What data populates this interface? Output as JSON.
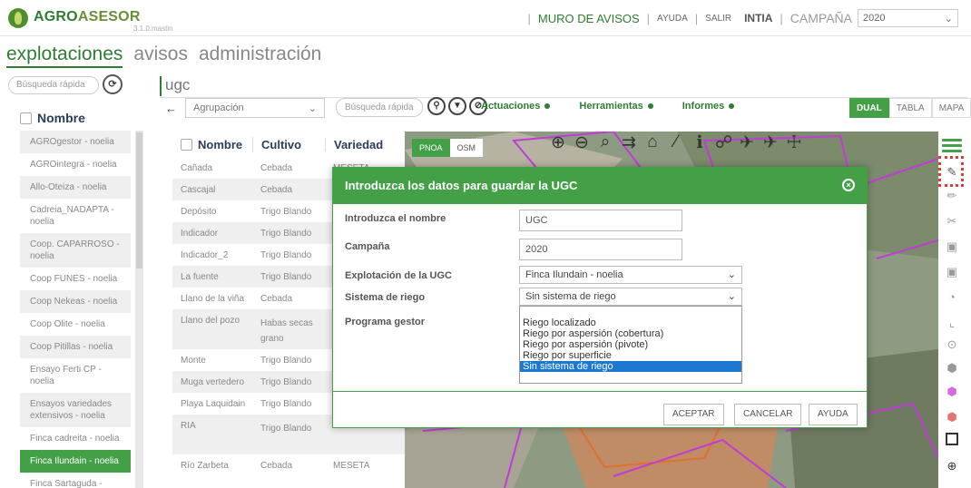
{
  "app": {
    "logo_agro": "AGRO",
    "logo_asesor": "ASESOR",
    "version": "3.1.0.mastin"
  },
  "topbar": {
    "muro": "MURO DE AVISOS",
    "ayuda": "AYUDA",
    "salir": "SALIR",
    "org": "INTIA",
    "campana_label": "CAMPAÑA",
    "campana_value": "2020"
  },
  "nav": {
    "tabs": [
      "explotaciones",
      "avisos",
      "administración"
    ]
  },
  "sidebar": {
    "search_placeholder": "Búsqueda rápida",
    "header": "Nombre",
    "items": [
      "AGROgestor - noelia",
      "AGROintegra - noelia",
      "Allo-Oteiza - noelia",
      "Cadreia_NADAPTA - noelia",
      "Coop. CAPARROSO - noelia",
      "Coop FUNES - noelia",
      "Coop Nekeas - noelia",
      "Coop Olite - noelia",
      "Coop Pitillas - noelia",
      "Ensayo Ferti CP - noelia",
      "Ensayos variedades extensivos - noelia",
      "Finca cadreita - noelia",
      "Finca Ilundain - noelia",
      "Finca Sartaguda - noelia"
    ]
  },
  "main": {
    "title": "ugc",
    "agrupacion": "Agrupación",
    "search_placeholder": "Búsqueda rápida",
    "menus": [
      "Actuaciones",
      "Herramientas",
      "Informes"
    ],
    "view": [
      "DUAL",
      "TABLA",
      "MAPA"
    ]
  },
  "table": {
    "headers": [
      "Nombre",
      "Cultivo",
      "Variedad"
    ],
    "rows": [
      [
        "Cañada",
        "Cebada",
        "MESETA"
      ],
      [
        "Cascajal",
        "Cebada",
        ""
      ],
      [
        "Depósito",
        "Trigo Blando",
        ""
      ],
      [
        "Indicador",
        "Trigo Blando",
        ""
      ],
      [
        "Indicador_2",
        "Trigo Blando",
        ""
      ],
      [
        "La fuente",
        "Trigo Blando",
        ""
      ],
      [
        "Llano de la viña",
        "Cebada",
        ""
      ],
      [
        "Llano del pozo",
        "Habas secas grano",
        ""
      ],
      [
        "Monte",
        "Trigo Blando",
        ""
      ],
      [
        "Muga vertedero",
        "Trigo Blando",
        ""
      ],
      [
        "Playa Laquidain",
        "Trigo Blando",
        ""
      ],
      [
        "RIA",
        "Trigo Blando",
        ""
      ],
      [
        "Río Zarbeta",
        "Cebada",
        "MESETA"
      ]
    ]
  },
  "map": {
    "tabs": [
      "PNOA",
      "OSM"
    ]
  },
  "modal": {
    "title": "Introduzca los datos para guardar la UGC",
    "nombre_label": "Introduzca el nombre",
    "nombre_value": "UGC",
    "campana_label": "Campaña",
    "campana_value": "2020",
    "explotacion_label": "Explotación de la UGC",
    "explotacion_value": "Finca Ilundain - noelia",
    "riego_label": "Sistema de riego",
    "riego_value": "Sin sistema de riego",
    "programa_label": "Programa gestor",
    "riego_options": [
      "Riego localizado",
      "Riego por aspersión (cobertura)",
      "Riego por aspersión (pivote)",
      "Riego por superficie",
      "Sin sistema de riego"
    ],
    "buttons": [
      "ACEPTAR",
      "CANCELAR",
      "AYUDA"
    ]
  }
}
